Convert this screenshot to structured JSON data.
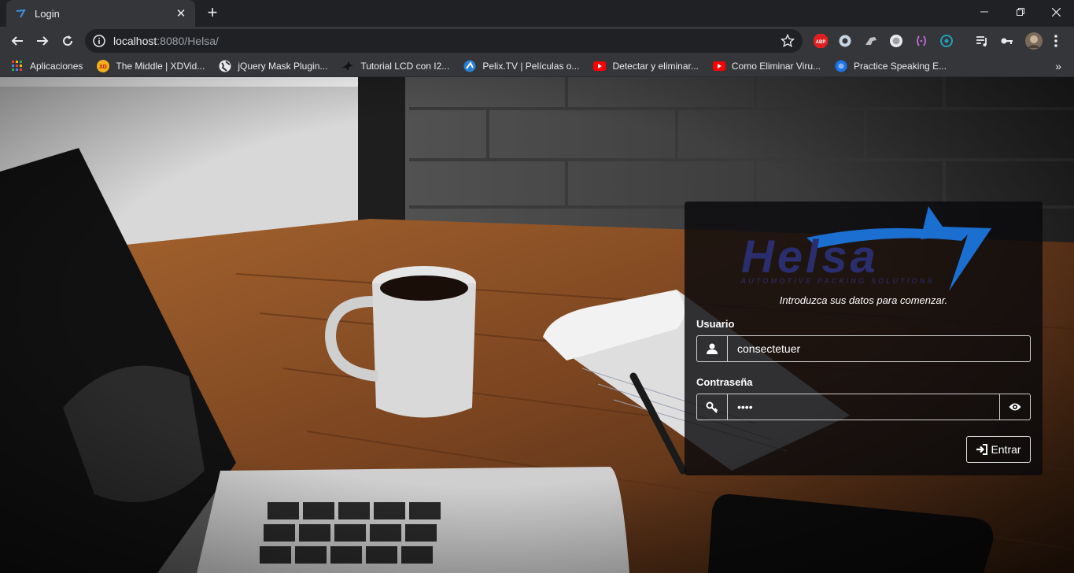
{
  "browser": {
    "tab_title": "Login",
    "url_host": "localhost",
    "url_rest": ":8080/Helsa/",
    "bookmarks": [
      {
        "label": "Aplicaciones",
        "icon": "apps-grid-icon"
      },
      {
        "label": "The Middle | XDVid...",
        "icon": "xd-icon"
      },
      {
        "label": "jQuery Mask Plugin...",
        "icon": "globe-icon"
      },
      {
        "label": "Tutorial LCD con I2...",
        "icon": "bird-icon"
      },
      {
        "label": "Pelix.TV | Películas o...",
        "icon": "pelix-icon"
      },
      {
        "label": "Detectar y eliminar...",
        "icon": "youtube-icon"
      },
      {
        "label": "Como Eliminar Viru...",
        "icon": "youtube-icon"
      },
      {
        "label": "Practice Speaking E...",
        "icon": "circle-blue-icon"
      }
    ],
    "extensions": [
      "adblock-icon",
      "ring-icon",
      "horse-icon",
      "record-icon",
      "brackets-icon",
      "target-icon",
      "playlist-icon",
      "key-icon",
      "profile-avatar"
    ]
  },
  "login": {
    "logo_text": "Helsa",
    "logo_tagline": "AUTOMOTIVE PACKING SOLUTIONS",
    "intro": "Introduzca sus datos para comenzar.",
    "username_label": "Usuario",
    "username_value": "consectetuer",
    "password_label": "Contraseña",
    "password_value": "••••",
    "submit_label": "Entrar"
  },
  "colors": {
    "logo_dark": "#2b2e6e",
    "logo_blue": "#1b6fd1",
    "panel_bg": "#0a0a0c"
  }
}
